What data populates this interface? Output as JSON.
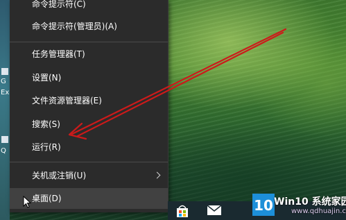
{
  "desktop": {
    "left_labels": [
      "G",
      "Ex",
      "Q"
    ]
  },
  "menu": {
    "items": [
      {
        "label": "命令提示符(C)"
      },
      {
        "label": "命令提示符(管理员)(A)"
      },
      {
        "label": "任务管理器(T)"
      },
      {
        "label": "设置(N)"
      },
      {
        "label": "文件资源管理器(E)"
      },
      {
        "label": "搜索(S)"
      },
      {
        "label": "运行(R)"
      },
      {
        "label": "关机或注销(U)"
      },
      {
        "label": "桌面(D)"
      }
    ]
  },
  "annotation": {
    "color": "#cc1a1a"
  },
  "taskbar": {
    "icons": [
      "store-icon",
      "mail-icon"
    ]
  },
  "watermark": {
    "logo_text": "10",
    "title": "Win10 系统家园",
    "url": "www.qdhuajin.com"
  }
}
